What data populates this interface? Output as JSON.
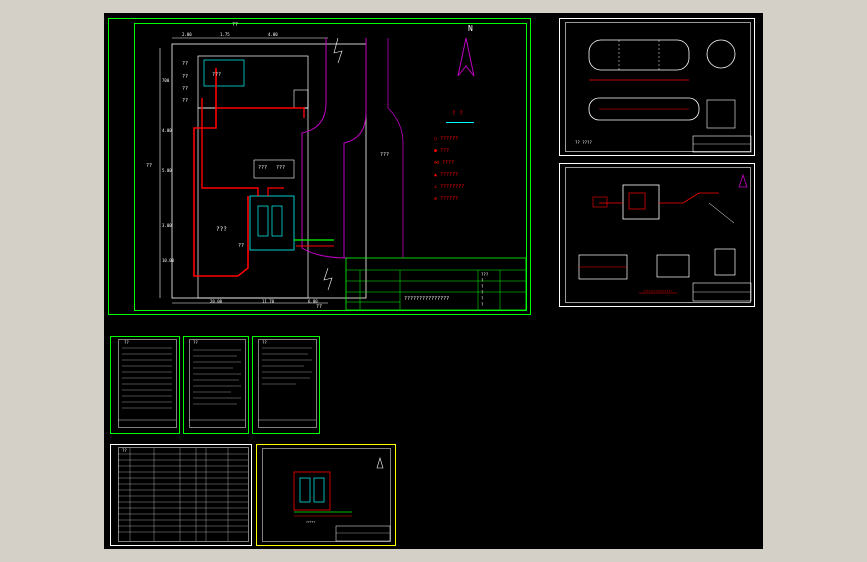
{
  "colors": {
    "background": "#000000",
    "frame_green": "#00ff00",
    "frame_yellow": "#ffff00",
    "line_white": "#ffffff",
    "pipe_red": "#ff0000",
    "road_magenta": "#c000c0",
    "equipment_cyan": "#00ffff"
  },
  "main_plan": {
    "north_letter": "N",
    "top_label": "??",
    "dim_top_1": "2.00",
    "dim_top_2": "1.75",
    "dim_top_3": "4.00",
    "dim_left_1": "700",
    "dim_left_2": "4.00",
    "dim_left_3": "5.00",
    "dim_left_4": "3.00",
    "dim_left_5": "10.00",
    "dim_bottom_1": "20.00",
    "dim_bottom_2": "11.70",
    "dim_bottom_3": "6.00",
    "side_label": "??",
    "bottom_label": "??",
    "room_labels": [
      "??",
      "??",
      "??",
      "??",
      "???"
    ],
    "center_room": "???",
    "tank_labels": [
      "???",
      "???"
    ],
    "tank_area_label": "??",
    "road_label": "???",
    "legend_title": "? ?",
    "legend_items": [
      "??????",
      "???",
      "????",
      "??????",
      "????????",
      "??????"
    ],
    "title_block_caption": "???????????????",
    "title_block_right": [
      "???",
      "?",
      "?",
      "?",
      "?",
      "?"
    ]
  },
  "tank_sheet": {
    "note": "?? ????"
  },
  "detail_sheet": {
    "note": "????????????????"
  },
  "text_sheets": {
    "headers": [
      "??",
      "??",
      "??",
      "??"
    ]
  },
  "small_plan": {
    "caption": "?????"
  }
}
